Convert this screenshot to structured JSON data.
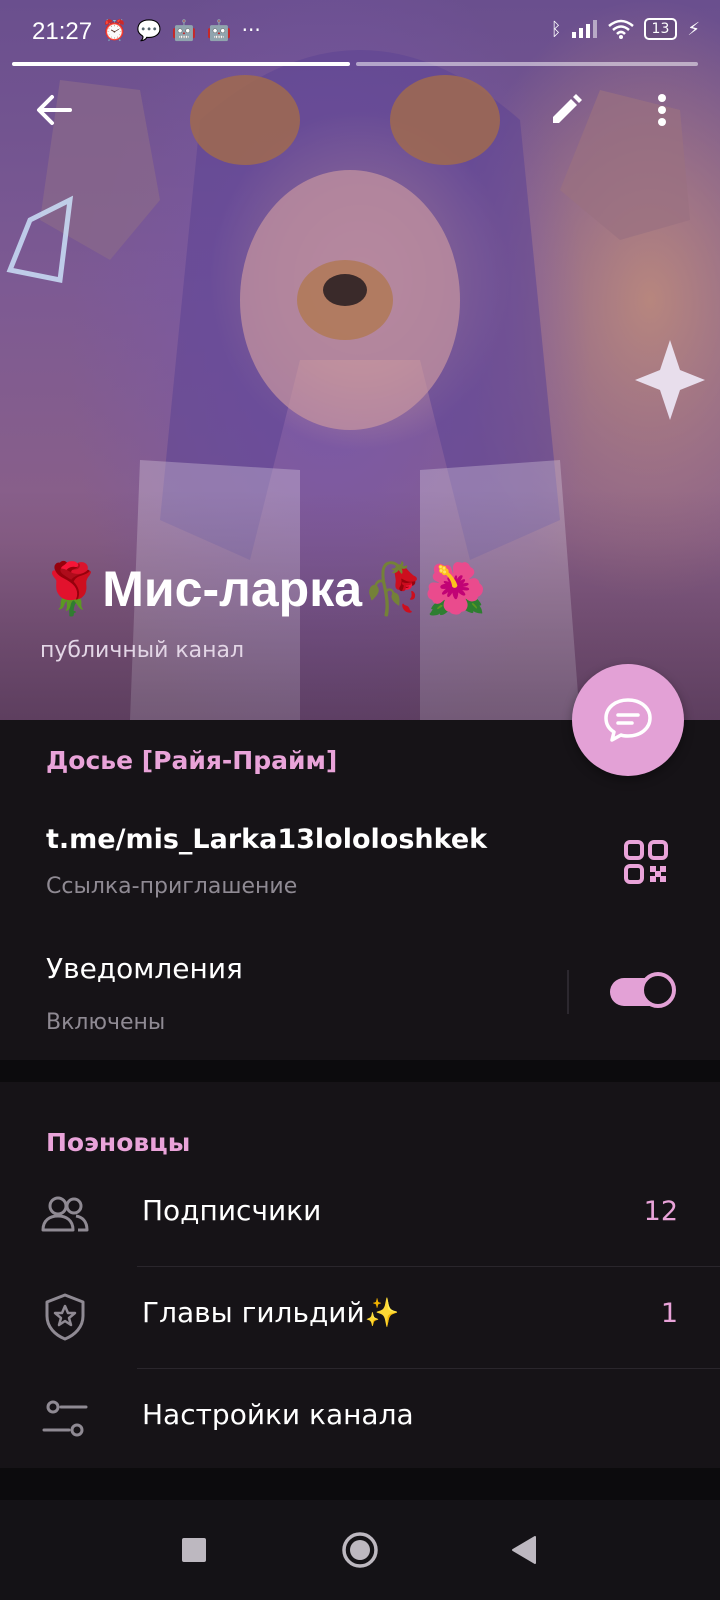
{
  "status_bar": {
    "time": "21:27",
    "left_icons": [
      "alarm-icon",
      "chat-bubble-icon",
      "android-icon",
      "android-icon",
      "more-dots-icon"
    ],
    "right_icons": [
      "bluetooth-icon",
      "signal-icon",
      "wifi-icon",
      "battery-icon",
      "charging-icon"
    ],
    "battery": "13",
    "story_progress": [
      1.0,
      0.0
    ]
  },
  "header": {
    "channel_name": "🌹Мис-ларка🥀🌺",
    "channel_type": "публичный канал"
  },
  "info": {
    "section_title": "Досье [Райя-Прайм]",
    "link": "t.me/mis_Larka13lololoshkek",
    "link_caption": "Ссылка-приглашение",
    "notifications_label": "Уведомления",
    "notifications_status": "Включены",
    "notifications_enabled": true
  },
  "members": {
    "section_title": "Поэновцы",
    "rows": [
      {
        "label": "Подписчики",
        "count": "12",
        "icon": "people-icon"
      },
      {
        "label": "Главы гильдий✨",
        "count": "1",
        "icon": "shield-star-icon"
      },
      {
        "label": "Настройки канала",
        "count": "",
        "icon": "settings-sliders-icon"
      }
    ]
  },
  "navigation": [
    "square-icon",
    "home-circle-icon",
    "back-triangle-icon"
  ],
  "colors": {
    "accent": "#e9a3d9",
    "fab": "#e3a1d6",
    "background": "#161317"
  }
}
